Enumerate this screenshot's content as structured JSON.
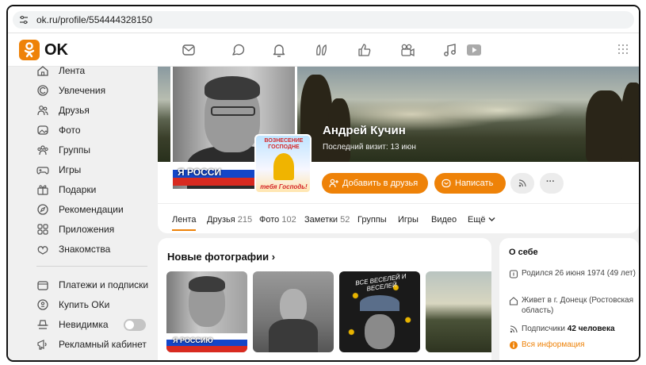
{
  "browser": {
    "url": "ok.ru/profile/554444328150"
  },
  "header": {
    "logo_text": "OK"
  },
  "sidebar": {
    "items": [
      {
        "label": "Лента",
        "icon": "home-icon"
      },
      {
        "label": "Увлечения",
        "icon": "hobby-icon"
      },
      {
        "label": "Друзья",
        "icon": "friends-icon"
      },
      {
        "label": "Фото",
        "icon": "photo-icon"
      },
      {
        "label": "Группы",
        "icon": "groups-icon"
      },
      {
        "label": "Игры",
        "icon": "gamepad-icon"
      },
      {
        "label": "Подарки",
        "icon": "gift-icon"
      },
      {
        "label": "Рекомендации",
        "icon": "compass-icon"
      },
      {
        "label": "Приложения",
        "icon": "apps-icon"
      },
      {
        "label": "Знакомства",
        "icon": "dating-icon"
      }
    ],
    "items2": [
      {
        "label": "Платежи и подписки",
        "icon": "wallet-icon"
      },
      {
        "label": "Купить ОКи",
        "icon": "coin-icon"
      },
      {
        "label": "Невидимка",
        "icon": "incognito-icon"
      },
      {
        "label": "Рекламный кабинет",
        "icon": "megaphone-icon"
      }
    ]
  },
  "profile": {
    "name": "Андрей Кучин",
    "last_visit": "Последний визит: 13 июн",
    "flag_text": "Я РОССИ",
    "sticker_top": "ВОЗНЕСЕНИЕ ГОСПОДНЕ",
    "sticker_bottom": "тебя Господь!",
    "add_friend_label": "Добавить в друзья",
    "write_label": "Написать",
    "more_label": "···"
  },
  "tabs": [
    {
      "label": "Лента",
      "count": ""
    },
    {
      "label": "Друзья",
      "count": "215"
    },
    {
      "label": "Фото",
      "count": "102"
    },
    {
      "label": "Заметки",
      "count": "52"
    },
    {
      "label": "Группы",
      "count": ""
    },
    {
      "label": "Игры",
      "count": ""
    },
    {
      "label": "Видео",
      "count": ""
    },
    {
      "label": "Ещё",
      "count": ""
    }
  ],
  "photos": {
    "title": "Новые фотографии",
    "chevron": "›",
    "flag_text": "Я РОССИЮ",
    "poster_text": "ВСЕ ВЕСЕЛЕЙ И ВЕСЕЛЕЙ"
  },
  "about": {
    "title": "О себе",
    "born": "Родился 26 июня 1974 (49 лет)",
    "lives": "Живет в г. Донецк (Ростовская область)",
    "followers_prefix": "Подписчики ",
    "followers_count": "42 человека",
    "all_info": "Вся информация"
  },
  "colors": {
    "accent": "#ee8208",
    "sidebar_bg": "#f0f0f0"
  }
}
